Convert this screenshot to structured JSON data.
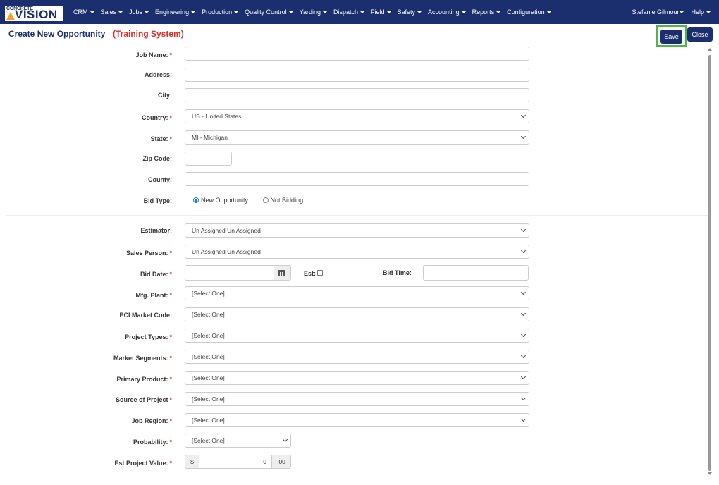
{
  "brand": {
    "logo_small": "CONCRETE",
    "logo_big": "VISION"
  },
  "nav": {
    "items": [
      "CRM",
      "Sales",
      "Jobs",
      "Engineering",
      "Production",
      "Quality Control",
      "Yarding",
      "Dispatch",
      "Field",
      "Safety",
      "Accounting",
      "Reports",
      "Configuration"
    ],
    "user": "Stefanie Gilmour",
    "help": "Help"
  },
  "header": {
    "title": "Create New Opportunity",
    "system_tag": "(Training System)",
    "save_label": "Save",
    "close_label": "Close"
  },
  "form": {
    "job_name": {
      "label": "Job Name:",
      "value": ""
    },
    "address": {
      "label": "Address:",
      "value": ""
    },
    "city": {
      "label": "City:",
      "value": ""
    },
    "country": {
      "label": "Country:",
      "value": "US - United States"
    },
    "state": {
      "label": "State:",
      "value": "MI - Michigan"
    },
    "zip": {
      "label": "Zip Code:",
      "value": ""
    },
    "county": {
      "label": "County:",
      "value": ""
    },
    "bid_type": {
      "label": "Bid Type:",
      "options": [
        "New Opportunity",
        "Not Bidding"
      ],
      "selected": "New Opportunity"
    },
    "estimator": {
      "label": "Estimator:",
      "value": "Un Assigned Un Assigned"
    },
    "sales_person": {
      "label": "Sales Person:",
      "value": "Un Assigned Un Assigned"
    },
    "bid_date": {
      "label": "Bid Date:",
      "value": ""
    },
    "est": {
      "label": "Est:",
      "checked": false
    },
    "bid_time": {
      "label": "Bid Time:",
      "value": ""
    },
    "mfg_plant": {
      "label": "Mfg. Plant:",
      "value": "[Select One]"
    },
    "pci_market_code": {
      "label": "PCI Market Code:",
      "value": "[Select One]"
    },
    "project_types": {
      "label": "Project Types:",
      "value": "[Select One]"
    },
    "market_segments": {
      "label": "Market Segments:",
      "value": "[Select One]"
    },
    "primary_product": {
      "label": "Primary Product:",
      "value": "[Select One]"
    },
    "source_of_project": {
      "label": "Source of Project",
      "value": "[Select One]"
    },
    "job_region": {
      "label": "Job Region:",
      "value": "[Select One]"
    },
    "probability": {
      "label": "Probability:",
      "value": "[Select One]"
    },
    "est_project_value": {
      "label": "Est Project Value:",
      "prefix": "$",
      "value": "0",
      "suffix": ".00"
    },
    "required_mark": "*"
  }
}
